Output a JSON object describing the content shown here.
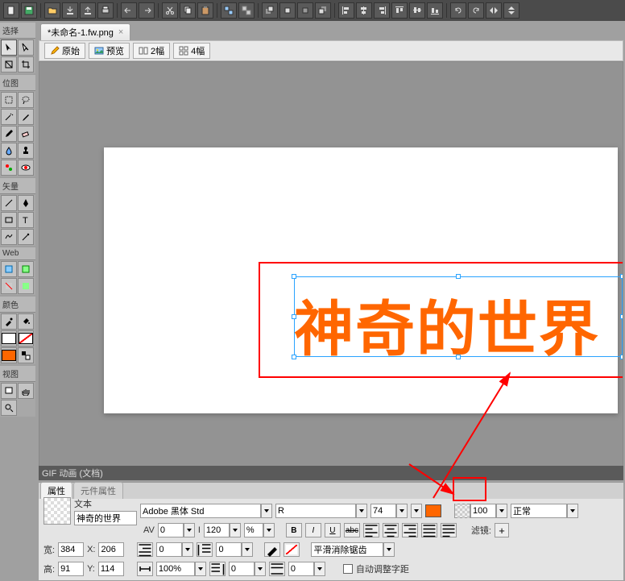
{
  "file_tab": {
    "label": "*未命名-1.fw.png"
  },
  "preview_bar": {
    "original": "原始",
    "preview": "预览",
    "two_up": "2幅",
    "four_up": "4幅"
  },
  "canvas_text": "神奇的世界",
  "gif_bar": "GIF 动画 (文档)",
  "panels": {
    "select": "选择",
    "bitmap": "位图",
    "vector": "矢量",
    "web": "Web",
    "colors": "颜色",
    "view": "视图"
  },
  "props": {
    "tab_properties": "属性",
    "tab_element": "元件属性",
    "type_label": "文本",
    "type_value": "神奇的世界",
    "font_family": "Adobe 黑体 Std",
    "font_style": "R",
    "font_size": "74",
    "opacity": "100",
    "blend_mode": "正常",
    "av": "AV",
    "av_value": "0",
    "leading": "120",
    "leading_unit": "%",
    "anti_alias": "平滑消除锯齿",
    "filters_label": "滤镜:",
    "width_label": "宽:",
    "width_value": "384",
    "x_label": "X:",
    "x_value": "206",
    "indent_value": "0",
    "height_label": "高:",
    "height_value": "91",
    "y_label": "Y:",
    "y_value": "114",
    "scale_value": "100%",
    "auto_kern": "自动调整字距"
  },
  "colors": {
    "text_fill": "#ff6600",
    "bg": "#ffffff"
  }
}
